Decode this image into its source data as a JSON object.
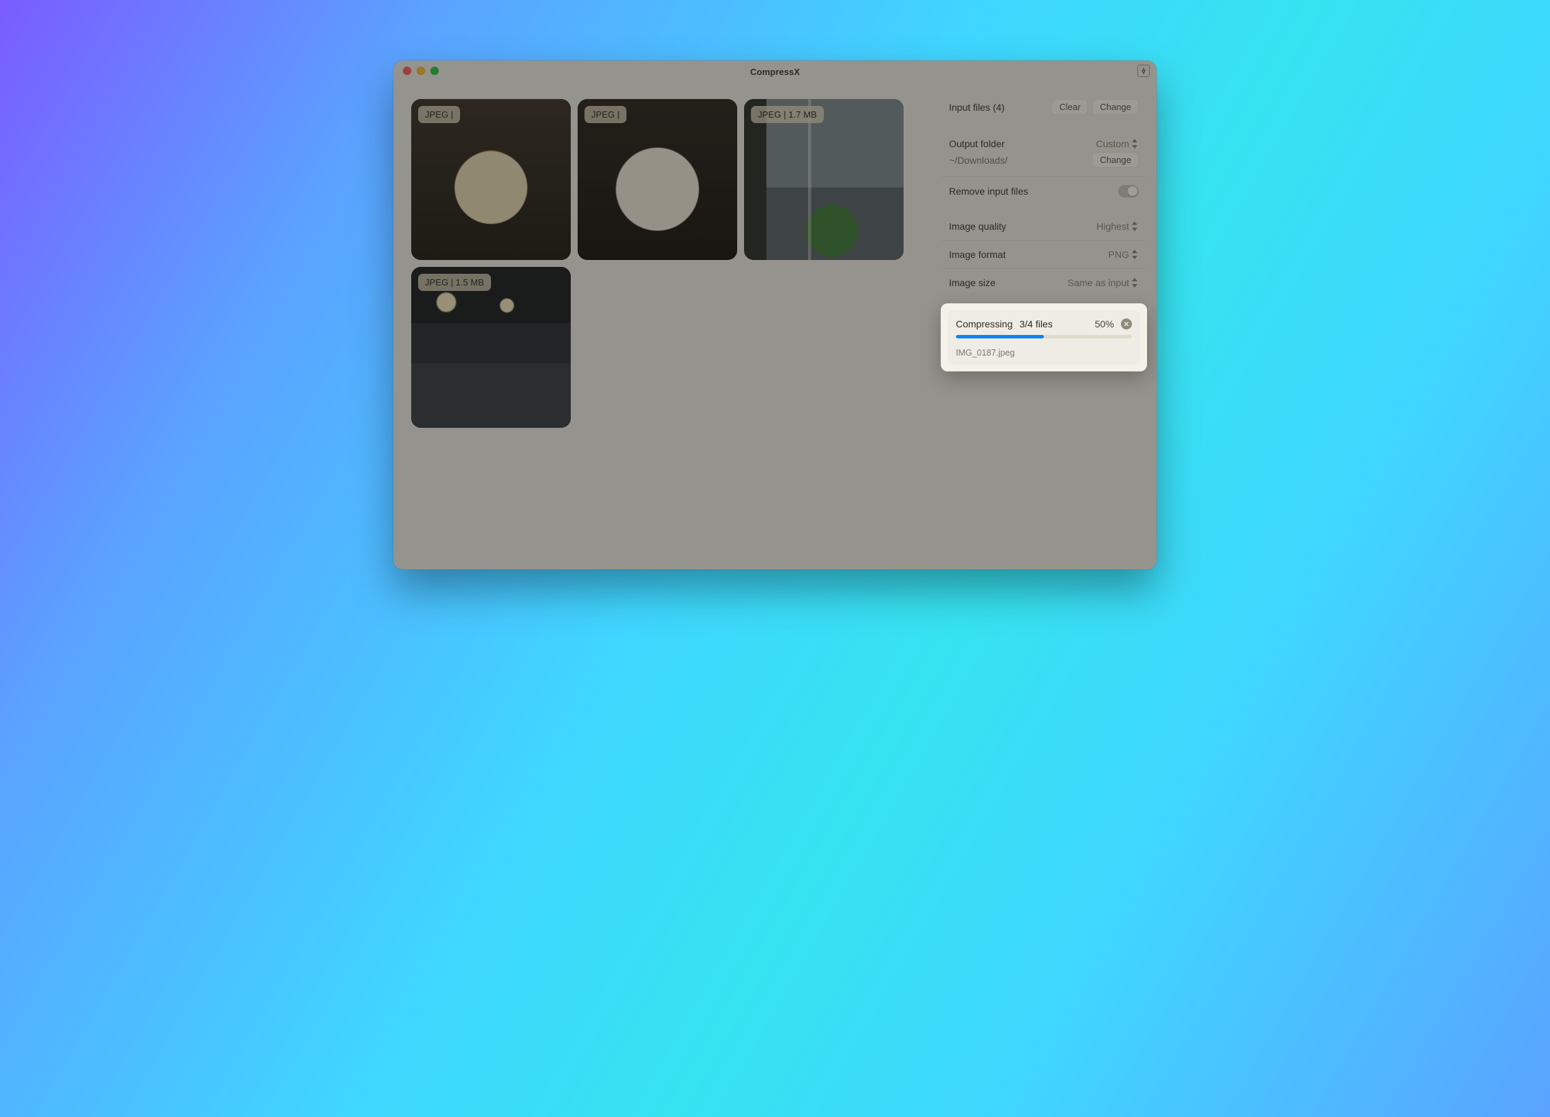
{
  "window": {
    "title": "CompressX"
  },
  "thumbnails": [
    {
      "badge": "JPEG |"
    },
    {
      "badge": "JPEG |"
    },
    {
      "badge": "JPEG | 1.7 MB"
    },
    {
      "badge": "JPEG | 1.5 MB"
    }
  ],
  "sidebar": {
    "input_files_label": "Input files (4)",
    "clear_label": "Clear",
    "change_label": "Change",
    "output_folder_label": "Output folder",
    "output_folder_mode": "Custom",
    "output_folder_path": "~/Downloads/",
    "output_change_label": "Change",
    "remove_input_label": "Remove input files",
    "remove_input_on": false,
    "image_quality_label": "Image quality",
    "image_quality_value": "Highest",
    "image_format_label": "Image format",
    "image_format_value": "PNG",
    "image_size_label": "Image size",
    "image_size_value": "Same as input"
  },
  "progress": {
    "status_label": "Compressing",
    "count_label": "3/4 files",
    "percent_label": "50%",
    "percent_value": 50,
    "current_file": "IMG_0187.jpeg"
  }
}
